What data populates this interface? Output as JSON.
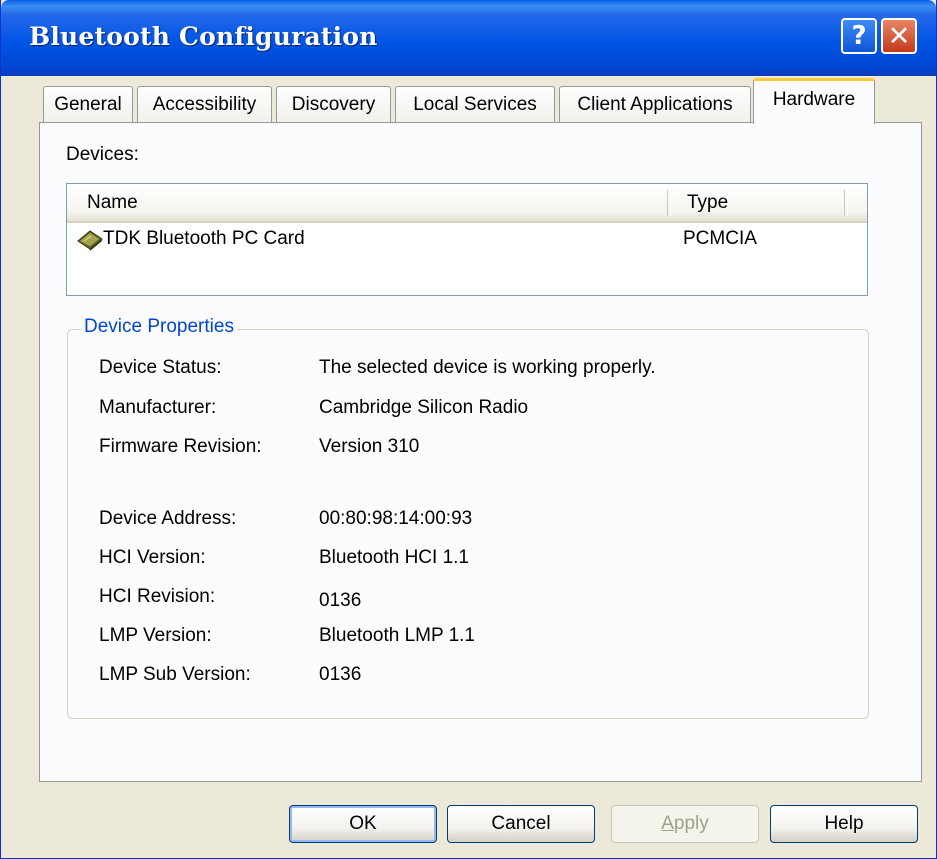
{
  "window": {
    "title": "Bluetooth Configuration",
    "help_glyph": "?",
    "close_glyph": "✕"
  },
  "tabs": [
    {
      "label": "General",
      "active": false
    },
    {
      "label": "Accessibility",
      "active": false
    },
    {
      "label": "Discovery",
      "active": false
    },
    {
      "label": "Local Services",
      "active": false
    },
    {
      "label": "Client Applications",
      "active": false
    },
    {
      "label": "Hardware",
      "active": true
    }
  ],
  "devices": {
    "label": "Devices:",
    "columns": [
      "Name",
      "Type"
    ],
    "rows": [
      {
        "name": "TDK Bluetooth PC Card",
        "type": "PCMCIA",
        "icon": "pc-card-icon"
      }
    ]
  },
  "properties": {
    "title": "Device Properties",
    "items": [
      {
        "label": "Device Status:",
        "value": "The selected device is working properly."
      },
      {
        "label": "Manufacturer:",
        "value": "Cambridge Silicon Radio"
      },
      {
        "label": "Firmware Revision:",
        "value": "Version 310"
      },
      {
        "label": "Device Address:",
        "value": "00:80:98:14:00:93"
      },
      {
        "label": "HCI Version:",
        "value": "Bluetooth HCI 1.1"
      },
      {
        "label": "HCI Revision:",
        "value": "0136"
      },
      {
        "label": "LMP Version:",
        "value": "Bluetooth LMP 1.1"
      },
      {
        "label": "LMP Sub Version:",
        "value": "0136"
      }
    ]
  },
  "buttons": {
    "ok": "OK",
    "cancel": "Cancel",
    "apply": "Apply",
    "help": "Help"
  },
  "colors": {
    "titlebar": "#0055E5",
    "active_tab_accent": "#FFC83C",
    "group_title": "#0046D5",
    "dialog_face": "#ECE9D8"
  }
}
